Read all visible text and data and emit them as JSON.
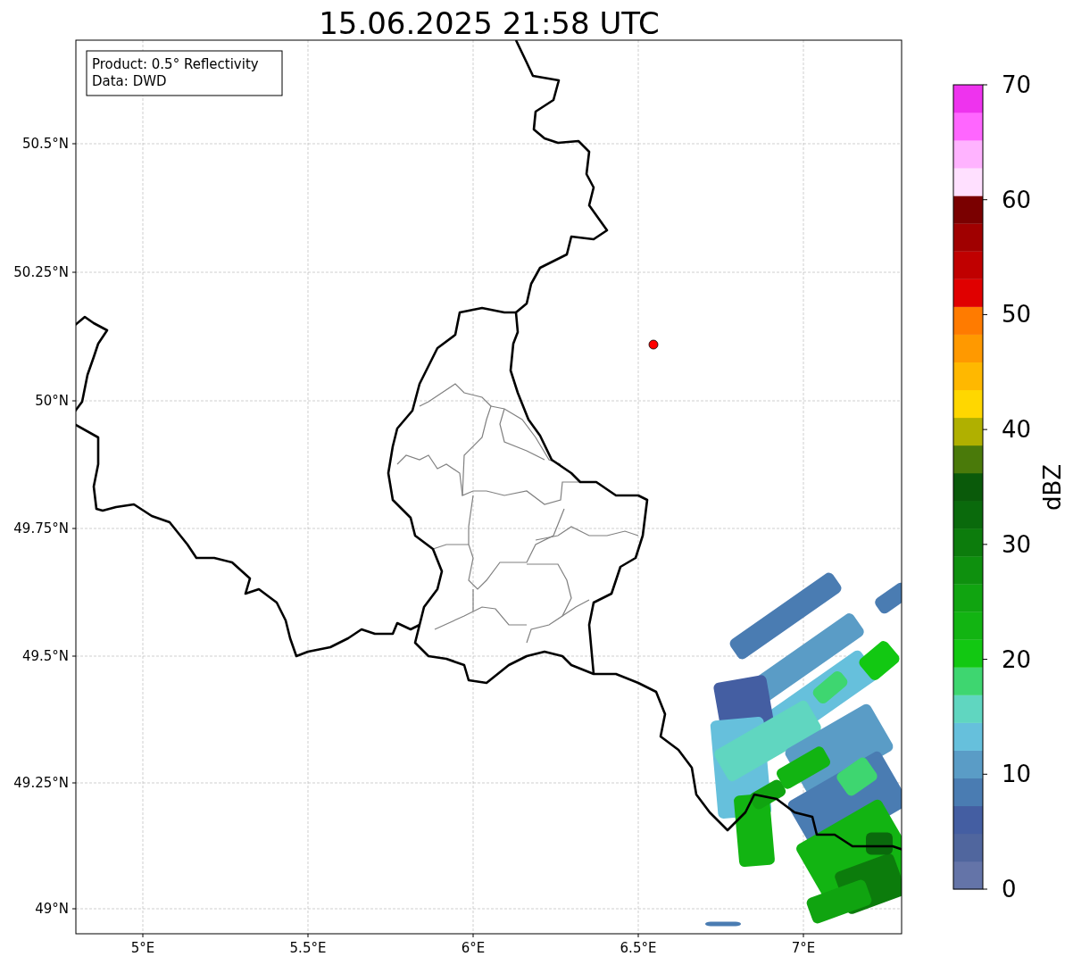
{
  "title": "15.06.2025 21:58 UTC",
  "info_box": [
    "Product: 0.5° Reflectivity",
    "Data: DWD"
  ],
  "map": {
    "x_ticks": [
      "5°E",
      "5.5°E",
      "6°E",
      "6.5°E",
      "7°E"
    ],
    "y_ticks": [
      "50.5°N",
      "50.25°N",
      "50°N",
      "49.75°N",
      "49.5°N",
      "49.25°N",
      "49°N"
    ]
  },
  "colorbar": {
    "label": "dBZ",
    "ticks": [
      "70",
      "60",
      "50",
      "40",
      "30",
      "20",
      "10",
      "0"
    ],
    "bins": [
      {
        "color": "#6474a8"
      },
      {
        "color": "#50669e"
      },
      {
        "color": "#445ea2"
      },
      {
        "color": "#4a7cb2"
      },
      {
        "color": "#5a9cc6"
      },
      {
        "color": "#66c0dc"
      },
      {
        "color": "#60d6c0"
      },
      {
        "color": "#3ed670"
      },
      {
        "color": "#12c812"
      },
      {
        "color": "#12b412"
      },
      {
        "color": "#10a410"
      },
      {
        "color": "#0e900e"
      },
      {
        "color": "#0c7c0c"
      },
      {
        "color": "#0a6a0c"
      },
      {
        "color": "#0a5a0a"
      },
      {
        "color": "#4a7a0a"
      },
      {
        "color": "#b0b000"
      },
      {
        "color": "#ffd700"
      },
      {
        "color": "#ffb800"
      },
      {
        "color": "#ff9900"
      },
      {
        "color": "#ff7b00"
      },
      {
        "color": "#e00000"
      },
      {
        "color": "#c00000"
      },
      {
        "color": "#a00000"
      },
      {
        "color": "#7a0000"
      },
      {
        "color": "#ffe0ff"
      },
      {
        "color": "#ffb3ff"
      },
      {
        "color": "#ff66ff"
      },
      {
        "color": "#ee33ee"
      }
    ]
  }
}
